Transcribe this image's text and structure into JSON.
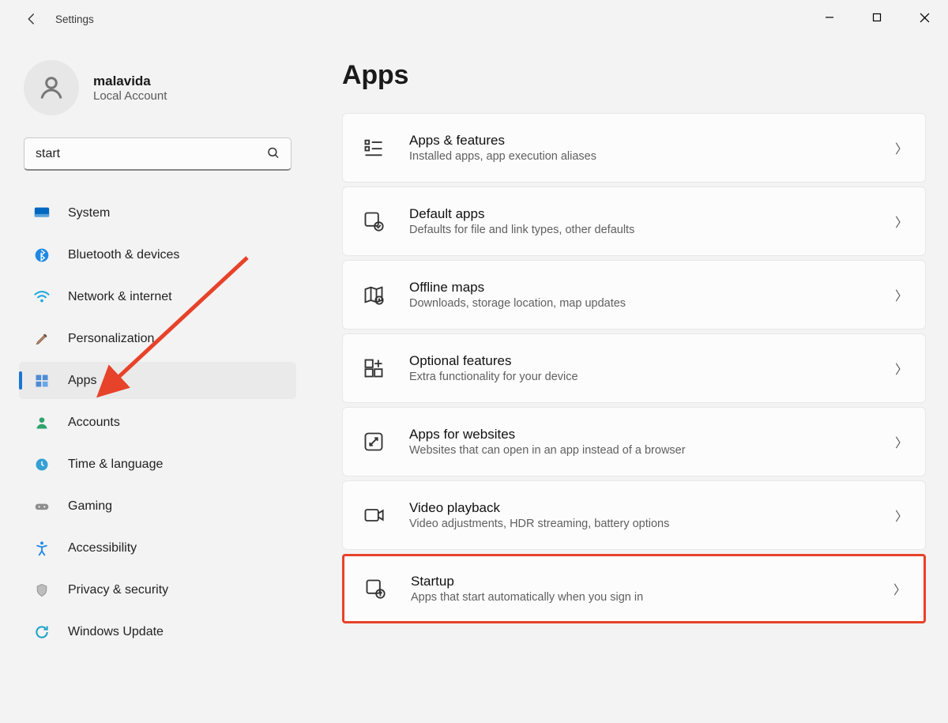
{
  "window": {
    "title": "Settings"
  },
  "user": {
    "name": "malavida",
    "subtitle": "Local Account"
  },
  "search": {
    "value": "start"
  },
  "sidebar": {
    "items": [
      {
        "id": "system",
        "label": "System"
      },
      {
        "id": "bluetooth",
        "label": "Bluetooth & devices"
      },
      {
        "id": "network",
        "label": "Network & internet"
      },
      {
        "id": "personal",
        "label": "Personalization"
      },
      {
        "id": "apps",
        "label": "Apps"
      },
      {
        "id": "accounts",
        "label": "Accounts"
      },
      {
        "id": "time",
        "label": "Time & language"
      },
      {
        "id": "gaming",
        "label": "Gaming"
      },
      {
        "id": "accessibility",
        "label": "Accessibility"
      },
      {
        "id": "privacy",
        "label": "Privacy & security"
      },
      {
        "id": "update",
        "label": "Windows Update"
      }
    ],
    "active": "apps"
  },
  "page": {
    "title": "Apps",
    "cards": [
      {
        "id": "apps-features",
        "title": "Apps & features",
        "sub": "Installed apps, app execution aliases"
      },
      {
        "id": "default-apps",
        "title": "Default apps",
        "sub": "Defaults for file and link types, other defaults"
      },
      {
        "id": "offline-maps",
        "title": "Offline maps",
        "sub": "Downloads, storage location, map updates"
      },
      {
        "id": "optional-features",
        "title": "Optional features",
        "sub": "Extra functionality for your device"
      },
      {
        "id": "apps-websites",
        "title": "Apps for websites",
        "sub": "Websites that can open in an app instead of a browser"
      },
      {
        "id": "video-playback",
        "title": "Video playback",
        "sub": "Video adjustments, HDR streaming, battery options"
      },
      {
        "id": "startup",
        "title": "Startup",
        "sub": "Apps that start automatically when you sign in"
      }
    ],
    "highlighted_card": "startup"
  },
  "annotation": {
    "arrow_color": "#e7422a",
    "highlight_color": "#e7422a"
  }
}
